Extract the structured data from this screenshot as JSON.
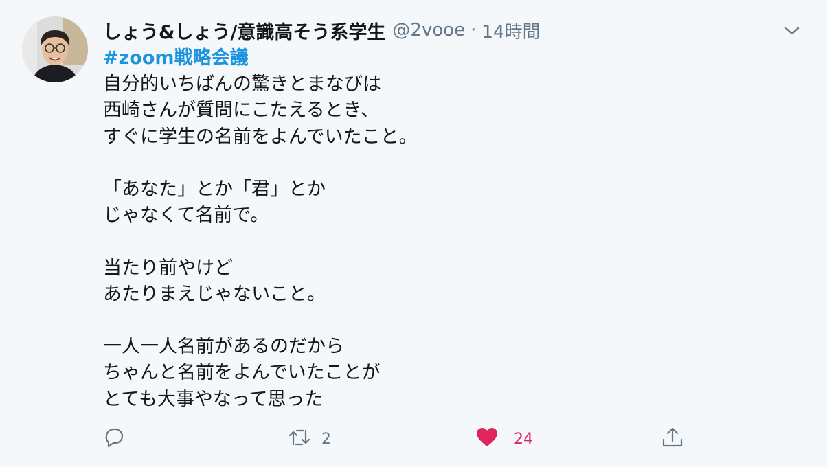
{
  "tweet": {
    "author_name": "しょう&しょう/意識高そう系学生",
    "handle": "@2vooe",
    "separator": "·",
    "time": "14時間",
    "hashtag": "#zoom戦略会議",
    "lines": [
      "自分的いちばんの驚きとまなびは",
      "西崎さんが質問にこたえるとき、",
      "すぐに学生の名前をよんでいたこと。",
      "",
      "「あなた」とか「君」とか",
      "じゃなくて名前で。",
      "",
      "当たり前やけど",
      "あたりまえじゃないこと。",
      "",
      "一人一人名前があるのだから",
      "ちゃんと名前をよんでいたことが",
      "とても大事やなって思った"
    ]
  },
  "actions": {
    "reply": {
      "icon": "reply-icon",
      "count": ""
    },
    "retweet": {
      "icon": "retweet-icon",
      "count": "2"
    },
    "like": {
      "icon": "heart-icon",
      "count": "24",
      "active": true,
      "color": "#e0245e"
    },
    "share": {
      "icon": "share-icon"
    }
  },
  "colors": {
    "background": "#f5f8fa",
    "text": "#14171a",
    "secondary": "#657786",
    "link": "#1b95e0",
    "like": "#e0245e"
  }
}
